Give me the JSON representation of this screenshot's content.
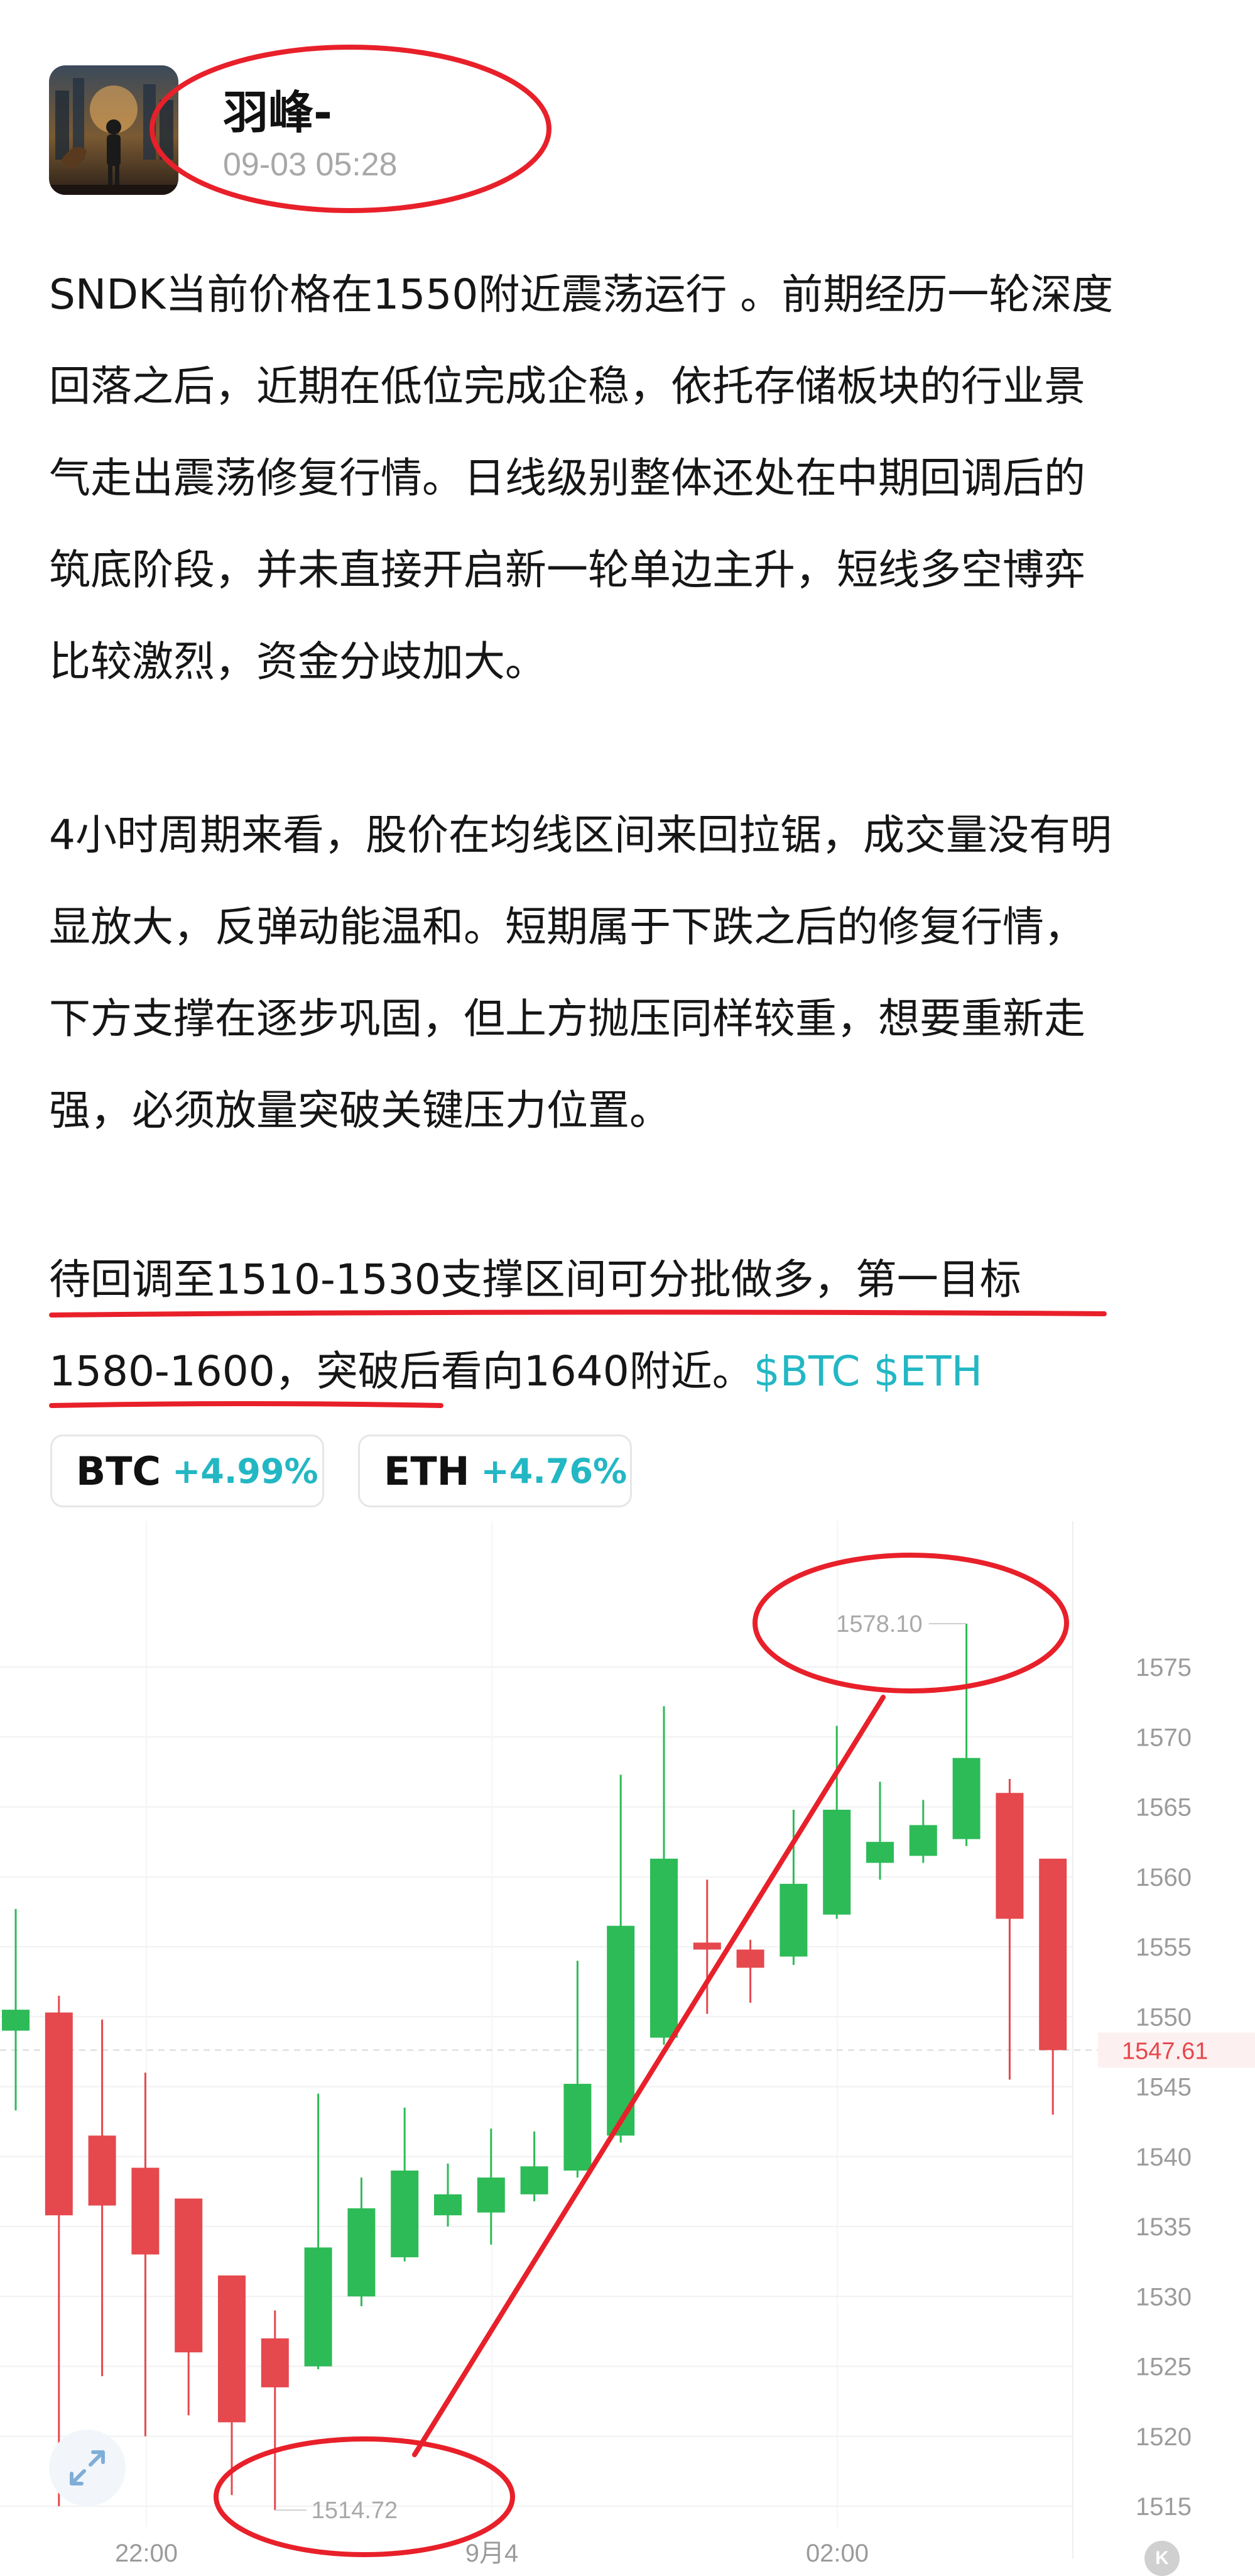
{
  "post": {
    "author": "羽峰-",
    "time": "09-03 05:28",
    "paragraphs": [
      [
        "SNDK当前价格在1550附近震荡运行 。前期经历一轮深度",
        "回落之后，近期在低位完成企稳，依托存储板块的行业景",
        "气走出震荡修复行情。日线级别整体还处在中期回调后的",
        "筑底阶段，并未直接开启新一轮单边主升，短线多空博弈",
        "比较激烈，资金分歧加大。"
      ],
      [
        "4小时周期来看，股价在均线区间来回拉锯，成交量没有明",
        "显放大，反弹动能温和。短期属于下跌之后的修复行情，",
        "下方支撑在逐步巩固，但上方抛压同样较重，想要重新走",
        "强，必须放量突破关键压力位置。"
      ],
      [
        "待回调至1510-1530支撑区间可分批做多，第一目标",
        "1580-1600，突破后看向1640附近。"
      ]
    ],
    "cashtags": "$BTC $ETH"
  },
  "tickers": [
    {
      "symbol": "BTC",
      "change": "+4.99%"
    },
    {
      "symbol": "ETH",
      "change": "+4.76%"
    }
  ],
  "colors": {
    "up": "#2dbb57",
    "down": "#e5484d",
    "accent": "#23b7c4",
    "annotation": "#e8202a"
  },
  "chart_data": {
    "type": "candlestick",
    "y_ticks": [
      1515,
      1520,
      1525,
      1530,
      1535,
      1540,
      1545,
      1550,
      1555,
      1560,
      1565,
      1570,
      1575
    ],
    "x_labels": [
      "22:00",
      "9月4",
      "02:00"
    ],
    "ylim": [
      1512.5,
      1582
    ],
    "high_label": "1578.10",
    "low_label": "1514.72",
    "last_price_label": "1547.61",
    "last_price": 1547.61,
    "candles": [
      {
        "o": 1549.0,
        "h": 1557.7,
        "l": 1543.3,
        "c": 1550.5
      },
      {
        "o": 1550.3,
        "h": 1551.5,
        "l": 1515.0,
        "c": 1535.8
      },
      {
        "o": 1541.5,
        "h": 1549.8,
        "l": 1524.3,
        "c": 1536.5
      },
      {
        "o": 1539.2,
        "h": 1546.0,
        "l": 1520.0,
        "c": 1533.0
      },
      {
        "o": 1537.0,
        "h": 1537.0,
        "l": 1521.5,
        "c": 1526.0
      },
      {
        "o": 1531.5,
        "h": 1531.5,
        "l": 1515.8,
        "c": 1521.0
      },
      {
        "o": 1527.0,
        "h": 1529.0,
        "l": 1514.72,
        "c": 1523.5
      },
      {
        "o": 1525.0,
        "h": 1544.5,
        "l": 1524.8,
        "c": 1533.5
      },
      {
        "o": 1530.0,
        "h": 1538.5,
        "l": 1529.3,
        "c": 1536.3
      },
      {
        "o": 1532.8,
        "h": 1543.5,
        "l": 1532.5,
        "c": 1539.0
      },
      {
        "o": 1535.8,
        "h": 1539.5,
        "l": 1535.0,
        "c": 1537.3
      },
      {
        "o": 1536.0,
        "h": 1542.0,
        "l": 1533.7,
        "c": 1538.5
      },
      {
        "o": 1537.3,
        "h": 1541.8,
        "l": 1536.8,
        "c": 1539.3
      },
      {
        "o": 1539.0,
        "h": 1554.0,
        "l": 1538.5,
        "c": 1545.2
      },
      {
        "o": 1541.5,
        "h": 1567.3,
        "l": 1541.0,
        "c": 1556.5
      },
      {
        "o": 1548.5,
        "h": 1572.2,
        "l": 1548.0,
        "c": 1561.3
      },
      {
        "o": 1555.3,
        "h": 1559.8,
        "l": 1550.2,
        "c": 1554.8
      },
      {
        "o": 1554.8,
        "h": 1555.5,
        "l": 1551.0,
        "c": 1553.5
      },
      {
        "o": 1554.3,
        "h": 1564.8,
        "l": 1553.7,
        "c": 1559.5
      },
      {
        "o": 1557.3,
        "h": 1570.8,
        "l": 1557.0,
        "c": 1564.8
      },
      {
        "o": 1561.0,
        "h": 1566.8,
        "l": 1559.8,
        "c": 1562.5
      },
      {
        "o": 1561.5,
        "h": 1565.5,
        "l": 1561.0,
        "c": 1563.7
      },
      {
        "o": 1562.7,
        "h": 1578.1,
        "l": 1562.2,
        "c": 1568.5
      },
      {
        "o": 1566.0,
        "h": 1567.0,
        "l": 1545.5,
        "c": 1557.0
      },
      {
        "o": 1561.3,
        "h": 1561.3,
        "l": 1543.0,
        "c": 1547.61
      }
    ]
  }
}
